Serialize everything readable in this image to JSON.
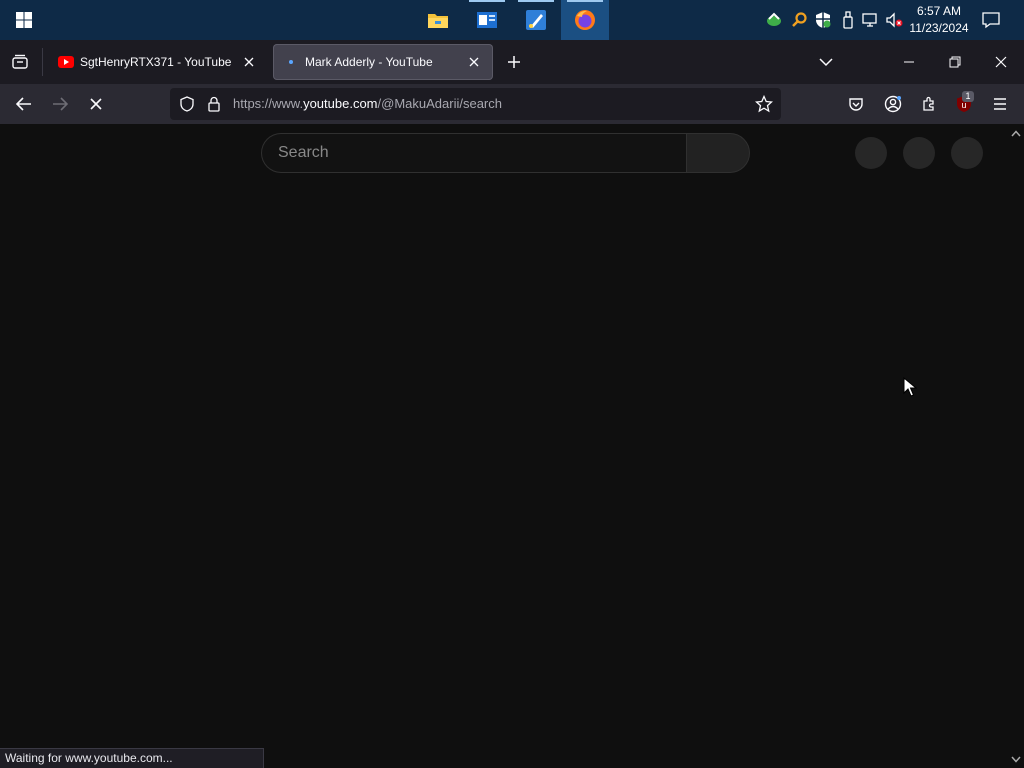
{
  "taskbar": {
    "apps": [
      {
        "name": "file-explorer"
      },
      {
        "name": "outlook"
      },
      {
        "name": "paint"
      },
      {
        "name": "firefox"
      }
    ],
    "clock_time": "6:57 AM",
    "clock_date": "11/23/2024"
  },
  "browser": {
    "tabs": [
      {
        "title": "SgtHenryRTX371 - YouTube",
        "active": false
      },
      {
        "title": "Mark Adderly - YouTube",
        "active": true
      }
    ],
    "url_prefix": "https://www.",
    "url_domain": "youtube.com",
    "url_path": "/@MakuAdarii/search",
    "extension_badge": "1"
  },
  "page": {
    "search_placeholder": "Search"
  },
  "status_text": "Waiting for www.youtube.com...",
  "colors": {
    "taskbar_bg": "#0e2a47",
    "tabstrip_bg": "#1c1b22",
    "navbar_bg": "#2b2a33",
    "page_bg": "#0f0f0f",
    "youtube_red": "#ff0000"
  }
}
